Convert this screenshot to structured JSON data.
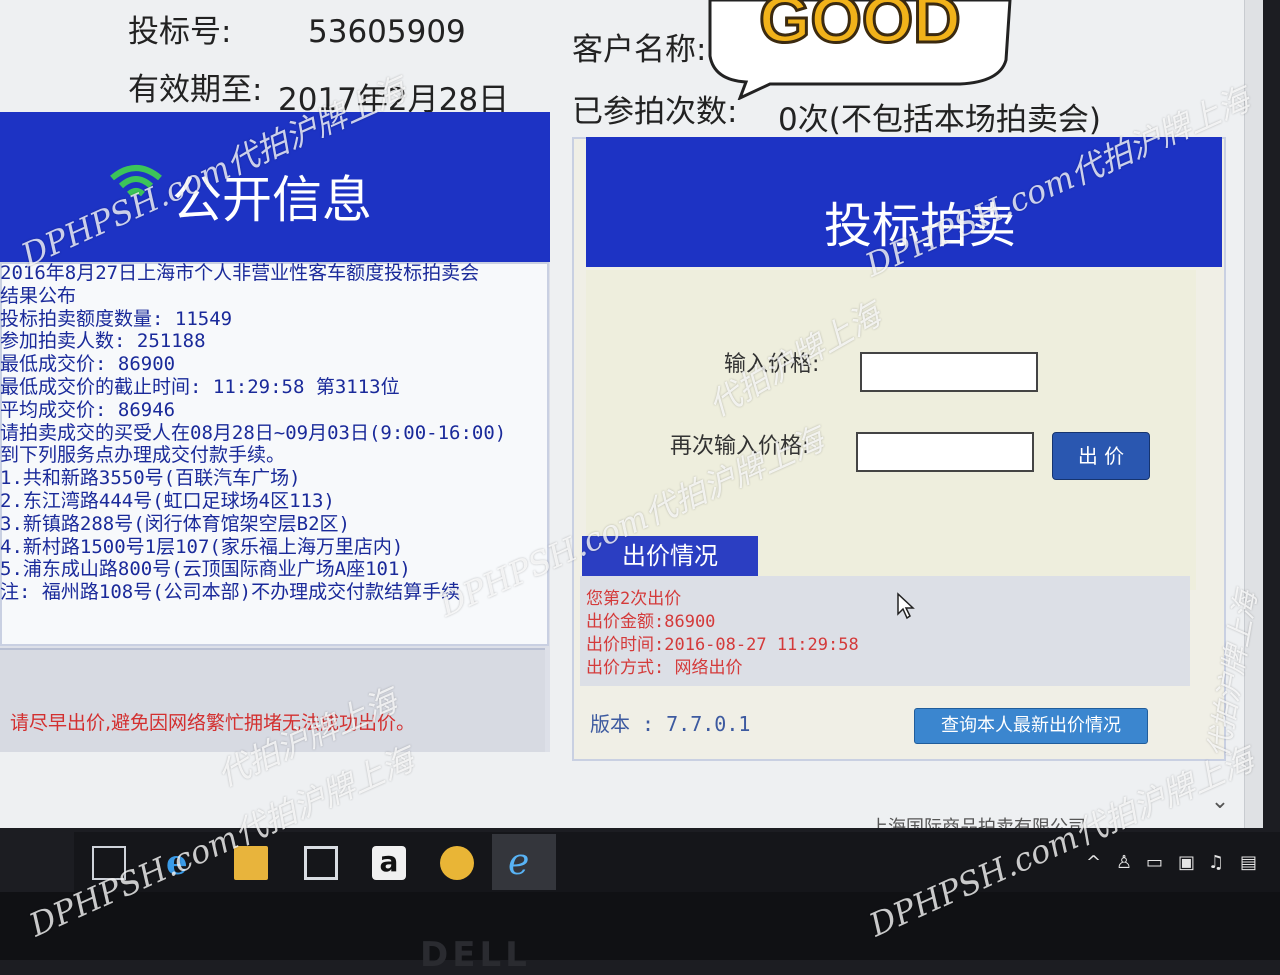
{
  "header": {
    "bid_no_label": "投标号:",
    "bid_no_value": "53605909",
    "customer_label": "客户名称:",
    "valid_label": "有效期至:",
    "valid_value": "2017年2月28日",
    "count_label": "已参拍次数:",
    "count_value": "0次(不包括本场拍卖会)"
  },
  "public_info": {
    "title": "公开信息",
    "lines": [
      "2016年8月27日上海市个人非营业性客车额度投标拍卖会",
      "结果公布",
      "投标拍卖额度数量: 11549",
      "参加拍卖人数: 251188",
      "最低成交价: 86900",
      "最低成交价的截止时间: 11:29:58 第3113位",
      "平均成交价: 86946",
      "请拍卖成交的买受人在08月28日~09月03日(9:00-16:00)",
      "到下列服务点办理成交付款手续。",
      "1.共和新路3550号(百联汽车广场)",
      "2.东江湾路444号(虹口足球场4区113)",
      "3.新镇路288号(闵行体育馆架空层B2区)",
      "4.新村路1500号1层107(家乐福上海万里店内)",
      "5.浦东成山路800号(云顶国际商业广场A座101)",
      "注: 福州路108号(公司本部)不办理成交付款结算手续"
    ],
    "warning": "请尽早出价,避免因网络繁忙拥堵无法成功出价。"
  },
  "auction": {
    "title": "投标拍卖",
    "price_label": "输入价格:",
    "price_value": "",
    "confirm_label": "再次输入价格:",
    "confirm_value": "",
    "bid_button": "出 价",
    "status_tab": "出价情况",
    "status_lines": [
      "您第2次出价",
      "出价金额:86900",
      "出价时间:2016-08-27 11:29:58",
      "出价方式: 网络出价"
    ],
    "version": "版本 : 7.7.0.1",
    "query_button": "查询本人最新出价情况",
    "footer_org": "上海国际商品拍卖有限公司"
  },
  "sticker": {
    "text": "GOOD"
  },
  "bezel": {
    "brand": "DELL"
  },
  "watermarks": [
    "DPHPSH.com代拍沪牌上海",
    "DPHPSH.com代拍沪牌上海",
    "DPHPSH.com代拍沪牌上海",
    "DPHPSH.com代拍沪牌上海",
    "DPHPSH.com代拍沪牌上海",
    "代拍沪牌上海",
    "代拍沪牌上海",
    "代拍沪牌上海"
  ],
  "colors": {
    "header_blue": "#1d33c4",
    "warning_red": "#d33030",
    "button_blue": "#2a57b0",
    "query_blue": "#3b86cf"
  },
  "icons": {
    "wifi": "wifi-icon",
    "cursor": "cursor-icon",
    "taskbar": [
      "task-view-icon",
      "edge-icon",
      "file-explorer-icon",
      "store-icon",
      "amazon-icon",
      "car-app-icon",
      "ie-icon"
    ],
    "tray": [
      "tray-up-arrow-icon",
      "user-icon",
      "battery-icon",
      "network-icon",
      "volume-icon",
      "notification-icon"
    ]
  }
}
